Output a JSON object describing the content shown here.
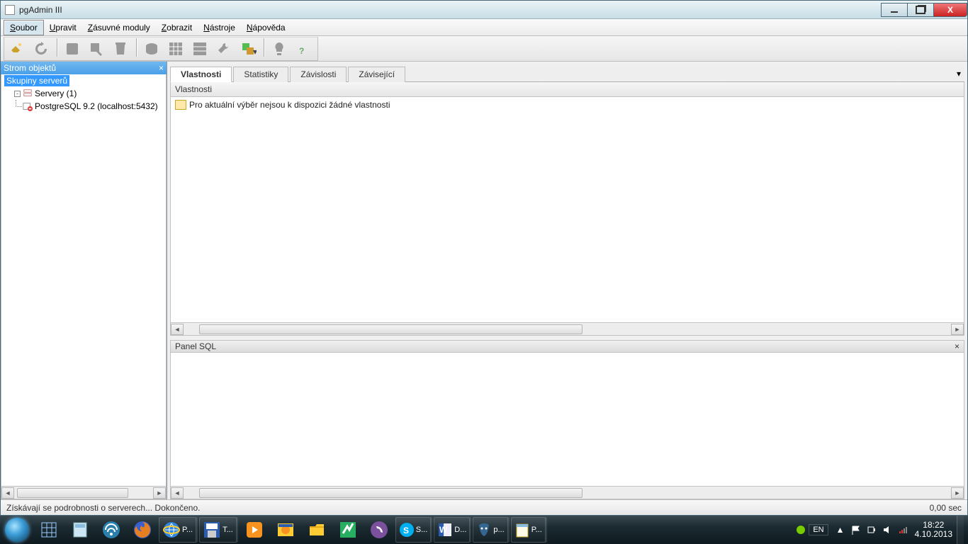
{
  "window": {
    "title": "pgAdmin III"
  },
  "menu": {
    "items": [
      {
        "label": "Soubor",
        "u": "S",
        "active": true
      },
      {
        "label": "Upravit",
        "u": "U"
      },
      {
        "label": "Zásuvné moduly",
        "u": "Z"
      },
      {
        "label": "Zobrazit",
        "u": "Z"
      },
      {
        "label": "Nástroje",
        "u": "N"
      },
      {
        "label": "Nápověda",
        "u": "N"
      }
    ]
  },
  "tree_panel": {
    "title": "Strom objektů",
    "root": "Skupiny serverů",
    "servers_label": "Servery (1)",
    "server_item": "PostgreSQL 9.2 (localhost:5432)"
  },
  "tabs": [
    {
      "label": "Vlastnosti",
      "active": true
    },
    {
      "label": "Statistiky"
    },
    {
      "label": "Závislosti"
    },
    {
      "label": "Závisející"
    }
  ],
  "properties": {
    "header": "Vlastnosti",
    "empty_msg": "Pro aktuální výběr nejsou k dispozici žádné vlastnosti"
  },
  "sql_panel": {
    "title": "Panel SQL"
  },
  "status": {
    "msg": "Získávají se podrobnosti o serverech... Dokončeno.",
    "time": "0,00 sec"
  },
  "taskbar": {
    "items": [
      {
        "label": "P..."
      },
      {
        "label": "T..."
      },
      {
        "label": ""
      },
      {
        "label": ""
      },
      {
        "label": ""
      },
      {
        "label": ""
      },
      {
        "label": ""
      },
      {
        "label": "S..."
      },
      {
        "label": "D..."
      },
      {
        "label": "p..."
      },
      {
        "label": "P..."
      }
    ],
    "lang": "EN",
    "time": "18:22",
    "date": "4.10.2013"
  }
}
